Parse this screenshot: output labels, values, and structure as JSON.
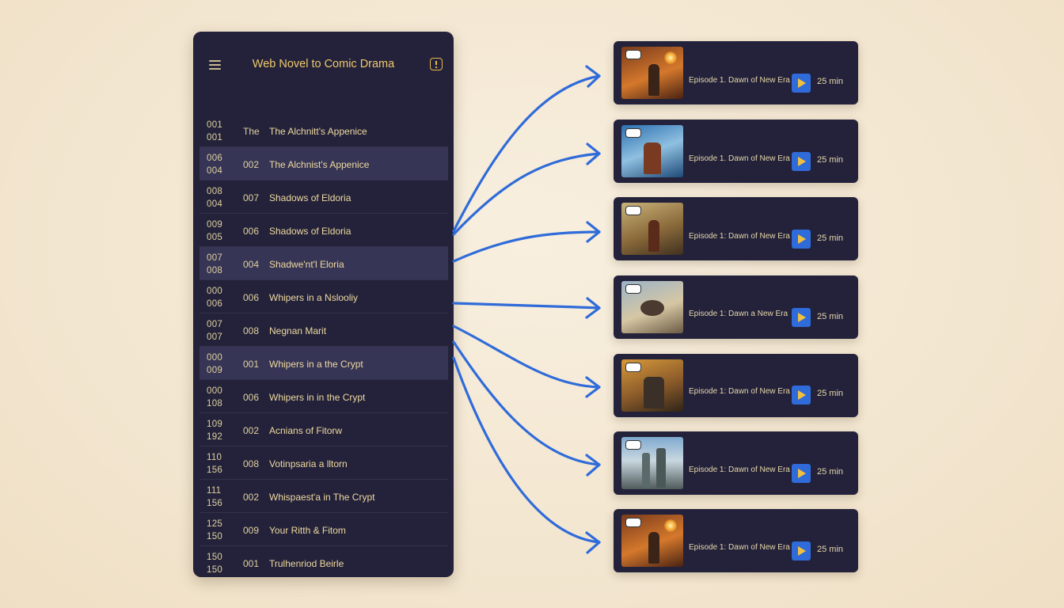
{
  "app": {
    "title": "Web Novel to Comic Drama"
  },
  "chapter_list": [
    {
      "n1": "001",
      "n2": "001",
      "ep": "The",
      "title": "The Alchnitt's Appenice",
      "highlighted": false
    },
    {
      "n1": "006",
      "n2": "004",
      "ep": "002",
      "title": "The Alchnist's Appenice",
      "highlighted": true
    },
    {
      "n1": "008",
      "n2": "004",
      "ep": "007",
      "title": "Shadows of Eldoria",
      "highlighted": false
    },
    {
      "n1": "009",
      "n2": "005",
      "ep": "006",
      "title": "Shadows of Eldoria",
      "highlighted": false
    },
    {
      "n1": "007",
      "n2": "008",
      "ep": "004",
      "title": "Shadwe'nt'l Eloria",
      "highlighted": true
    },
    {
      "n1": "000",
      "n2": "006",
      "ep": "006",
      "title": "Whipers in a Nslooliy",
      "highlighted": false
    },
    {
      "n1": "007",
      "n2": "007",
      "ep": "008",
      "title": "Negnan Marit",
      "highlighted": false
    },
    {
      "n1": "000",
      "n2": "009",
      "ep": "001",
      "title": "Whipers in a the Crypt",
      "highlighted": true
    },
    {
      "n1": "000",
      "n2": "108",
      "ep": "006",
      "title": "Whipers in in the Crypt",
      "highlighted": false
    },
    {
      "n1": "109",
      "n2": "192",
      "ep": "002",
      "title": "Acnians of Fitorw",
      "highlighted": false
    },
    {
      "n1": "110",
      "n2": "156",
      "ep": "008",
      "title": "Votinpsaria a lltorn",
      "highlighted": false
    },
    {
      "n1": "111",
      "n2": "156",
      "ep": "002",
      "title": "Whispaest'a in The Crypt",
      "highlighted": false
    },
    {
      "n1": "125",
      "n2": "150",
      "ep": "009",
      "title": "Your Ritth & Fitom",
      "highlighted": false
    },
    {
      "n1": "150",
      "n2": "150",
      "ep": "001",
      "title": "Trulhenriod Beirle",
      "highlighted": false
    }
  ],
  "episodes": [
    {
      "title": "Episode 1. Dawn of New Era",
      "duration": "25 min",
      "thumb": "alchemist-fire"
    },
    {
      "title": "Episode 1. Dawn of New Era",
      "duration": "25 min",
      "thumb": "flying-wizard"
    },
    {
      "title": "Episode 1: Dawn of New Era",
      "duration": "25 min",
      "thumb": "robed-mage"
    },
    {
      "title": "Episode 1: Dawn a New Era",
      "duration": "25 min",
      "thumb": "dragon"
    },
    {
      "title": "Episode 1: Dawn of New Era",
      "duration": "25 min",
      "thumb": "stone-giant"
    },
    {
      "title": "Episode 1: Dawn of New Era",
      "duration": "25 min",
      "thumb": "castle-city"
    },
    {
      "title": "Episode 1: Dawn of New Era",
      "duration": "25 min",
      "thumb": "alchemist-fire"
    }
  ],
  "colors": {
    "page_bg": "#f3e6d0",
    "panel_bg": "#23223a",
    "row_highlight": "#363555",
    "title_gold": "#f0c96a",
    "arrow_blue": "#2f6bd9",
    "play_blue": "#2f6bd9"
  },
  "icons": {
    "menu": "hamburger-icon",
    "info": "info-icon",
    "play": "play-icon"
  }
}
